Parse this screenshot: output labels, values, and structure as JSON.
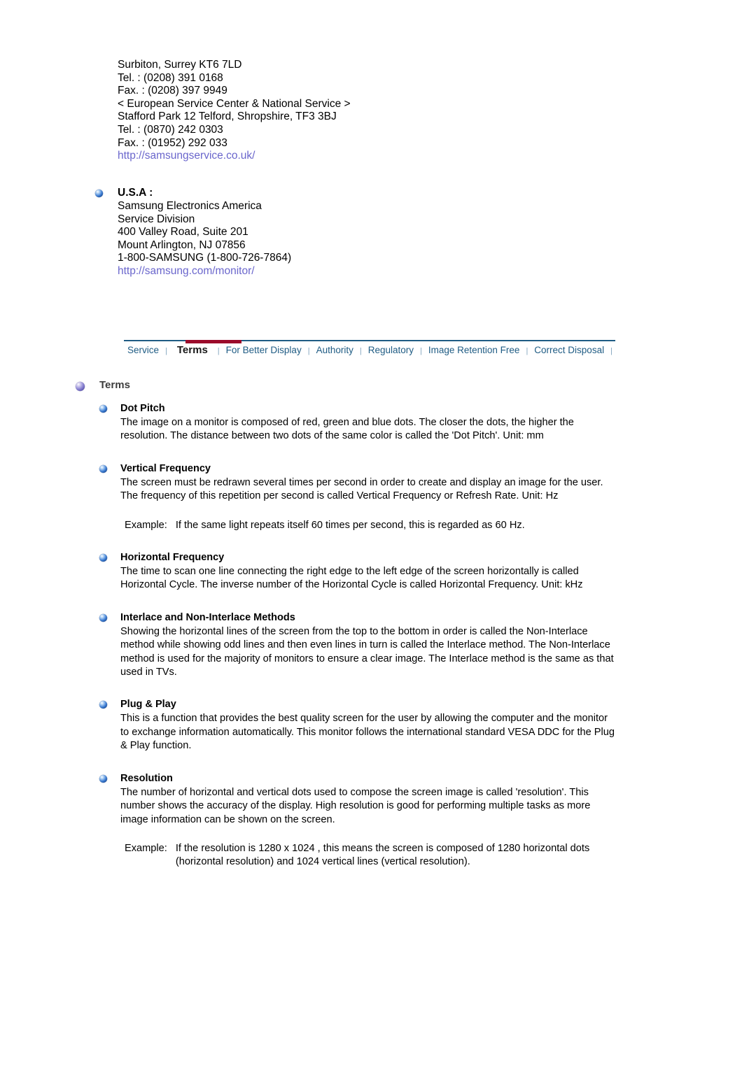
{
  "contact": {
    "lines": [
      "Surbiton, Surrey KT6 7LD",
      "Tel. : (0208) 391 0168",
      "Fax. : (0208) 397 9949",
      "< European Service Center & National Service >",
      "Stafford Park 12 Telford, Shropshire, TF3 3BJ",
      "Tel. : (0870) 242 0303",
      "Fax. : (01952) 292 033"
    ],
    "link": "http://samsungservice.co.uk/"
  },
  "region": {
    "heading": "U.S.A :",
    "lines": [
      "Samsung Electronics America",
      "Service Division",
      "400 Valley Road, Suite 201",
      "Mount Arlington, NJ 07856",
      "1-800-SAMSUNG (1-800-726-7864)"
    ],
    "link": "http://samsung.com/monitor/"
  },
  "tabbar": {
    "separator": "|",
    "tabs": [
      {
        "label": "Service",
        "active": false
      },
      {
        "label": "Terms",
        "active": true
      },
      {
        "label": "For Better Display",
        "active": false
      },
      {
        "label": "Authority",
        "active": false
      },
      {
        "label": "Regulatory",
        "active": false
      },
      {
        "label": "Image Retention Free",
        "active": false
      },
      {
        "label": "Correct Disposal",
        "active": false
      }
    ],
    "active_color": "#9b0a2a",
    "rule_color": "#1f5c84",
    "link_color": "#1f5c84"
  },
  "terms": {
    "title": "Terms",
    "entries": [
      {
        "title": "Dot Pitch",
        "body": "The image on a monitor is composed of red, green and blue dots. The closer the dots, the higher the resolution. The distance between two dots of the same color is called the 'Dot Pitch'. Unit: mm",
        "example_label": "",
        "example_text": ""
      },
      {
        "title": "Vertical Frequency",
        "body": "The screen must be redrawn several times per second in order to create and display an image for the user. The frequency of this repetition per second is called Vertical Frequency or Refresh Rate. Unit: Hz",
        "example_label": "Example:",
        "example_text": "If the same light repeats itself 60 times per second, this is regarded as 60 Hz."
      },
      {
        "title": "Horizontal Frequency",
        "body": "The time to scan one line connecting the right edge to the left edge of the screen horizontally is called Horizontal Cycle. The inverse number of the Horizontal Cycle is called Horizontal Frequency. Unit: kHz",
        "example_label": "",
        "example_text": ""
      },
      {
        "title": "Interlace and Non-Interlace Methods",
        "body": "Showing the horizontal lines of the screen from the top to the bottom in order is called the Non-Interlace method while showing odd lines and then even lines in turn is called the Interlace method. The Non-Interlace method is used for the majority of monitors to ensure a clear image. The Interlace method is the same as that used in TVs.",
        "example_label": "",
        "example_text": ""
      },
      {
        "title": "Plug & Play",
        "body": "This is a function that provides the best quality screen for the user by allowing the computer and the monitor to exchange information automatically. This monitor follows the international standard VESA DDC for the Plug & Play function.",
        "example_label": "",
        "example_text": ""
      },
      {
        "title": "Resolution",
        "body": "The number of horizontal and vertical dots used to compose the screen image is called 'resolution'. This number shows the accuracy of the display. High resolution is good for performing multiple tasks as more image information can be shown on the screen.",
        "example_label": "Example:",
        "example_text": "If the resolution is 1280 x 1024 , this means the screen is composed of 1280 horizontal dots (horizontal resolution) and 1024 vertical lines (vertical resolution)."
      }
    ]
  },
  "colors": {
    "link": "#6a66cc",
    "accent_red": "#9b0a2a",
    "accent_blue": "#1f5c84",
    "text": "#000000"
  }
}
